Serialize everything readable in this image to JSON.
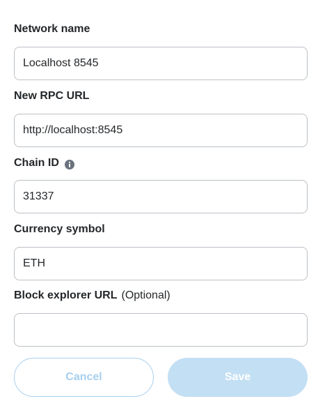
{
  "form": {
    "network_name": {
      "label": "Network name",
      "value": "Localhost 8545"
    },
    "rpc_url": {
      "label": "New RPC URL",
      "value": "http://localhost:8545"
    },
    "chain_id": {
      "label": "Chain ID",
      "value": "31337",
      "info_icon": "info-icon"
    },
    "currency_symbol": {
      "label": "Currency symbol",
      "value": "ETH"
    },
    "block_explorer": {
      "label": "Block explorer URL",
      "optional": "(Optional)",
      "value": ""
    }
  },
  "actions": {
    "cancel_label": "Cancel",
    "save_label": "Save"
  },
  "colors": {
    "text": "#24272a",
    "border": "#bbc0c5",
    "cancel_text": "#a7cfee",
    "save_bg": "#c3dff4",
    "info_icon": "#6a737d"
  }
}
